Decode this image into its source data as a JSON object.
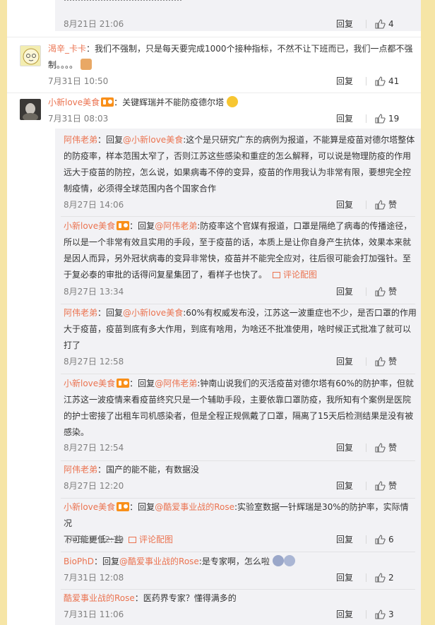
{
  "comments": [
    {
      "top_time": "8月21日 21:06",
      "reply_label": "回复",
      "likes": "4"
    },
    {
      "user": "渴辛_卡卡",
      "text": "：我们不强制，只是每天要完成1000个接种指标，不然不让下班而已，我们一点都不强制。。。。",
      "time": "7月31日 10:50",
      "reply_label": "回复",
      "likes": "41"
    },
    {
      "user": "小新love美食",
      "text": "：关键辉瑞并不能防疫德尔塔",
      "time": "7月31日 08:03",
      "reply_label": "回复",
      "likes": "19",
      "subs": [
        {
          "user": "阿伟老弟",
          "reply_prefix": "：回复",
          "mention": "@小新love美食",
          "line1": ":这个是只研究广东的病例为报道，不能算是疫苗对德尔塔整体",
          "line2": "的防疫率，样本范围太窄了，否则江苏这些感染和重症的怎么解释，可以说是物理防疫的作用",
          "line3": "远大于疫苗的防控，怎么说，如果病毒不停的变异，疫苗的作用我认为非常有限，要想完全控",
          "line4": "制疫情，必须得全球范围内各个国家合作",
          "time": "8月27日 14:06",
          "reply_label": "回复",
          "likes": "赞"
        },
        {
          "user": "小新love美食",
          "reply_prefix": "：回复",
          "mention": "@阿伟老弟",
          "line1": ":防疫率这个官媒有报道，口罩是隔绝了病毒的传播途径，",
          "line2": "所以是一个非常有效且实用的手段，至于疫苗的话，本质上是让你自身产生抗体，效果本来就",
          "line3": "是因人而异，另外冠状病毒的变异非常快，疫苗并不能完全应对，往后很可能会打加强针。至",
          "line4": "于复必泰的审批的话得问复星集团了，看样子也快了。",
          "pic_label": "评论配图",
          "time": "8月27日 13:34",
          "reply_label": "回复",
          "likes": "赞"
        },
        {
          "user": "阿伟老弟",
          "reply_prefix": "：回复",
          "mention": "@小新love美食",
          "line1": ":60%有权威发布没，江苏这一波重症也不少，是否口罩的作用",
          "line2": "大于疫苗，疫苗到底有多大作用，到底有啥用，为啥还不批准使用，啥时候正式批准了就可以",
          "line3": "打了",
          "time": "8月27日 12:58",
          "reply_label": "回复",
          "likes": "赞"
        },
        {
          "user": "小新love美食",
          "reply_prefix": "：回复",
          "mention": "@阿伟老弟",
          "line1": ":钟南山说我们的灭活疫苗对德尔塔有60%的防护率，但就",
          "line2": "江苏这一波疫情来看疫苗终究只是一个辅助手段，主要依靠口罩防疫，我所知有个案例是医院",
          "line3": "的护士密接了出租车司机感染者，但是全程正规佩戴了口罩，隔离了15天后检测结果是没有被",
          "line4": "感染。",
          "time": "8月27日 12:54",
          "reply_label": "回复",
          "likes": "赞"
        },
        {
          "user": "阿伟老弟",
          "text": "：国产的能不能，有数据没",
          "time": "8月27日 12:20",
          "reply_label": "回复",
          "likes": "赞"
        },
        {
          "user": "小新love美食",
          "reply_prefix": "：回复",
          "mention": "@酷爱事业战的Rose",
          "line1": ":实验室数据一针辉瑞是30%的防护率，实际情况",
          "line2": "下可能更低一些",
          "pic_label": "评论配图",
          "time": "7月31日 12:10",
          "reply_label": "回复",
          "likes": "6"
        },
        {
          "user": "BioPhD",
          "reply_prefix": "：回复",
          "mention": "@酷爱事业战的Rose",
          "line1": ":是专家啊，怎么啦",
          "time": "7月31日 12:08",
          "reply_label": "回复",
          "likes": "2"
        },
        {
          "user": "酷爱事业战的Rose",
          "text": "：医药界专家？懂得满多的",
          "time": "7月31日 11:06",
          "reply_label": "回复",
          "likes": "3"
        }
      ]
    }
  ],
  "colors": {
    "page_bg": "#f6e5a6",
    "username": "#eb7350",
    "sub_bg": "#f2f2f5"
  }
}
